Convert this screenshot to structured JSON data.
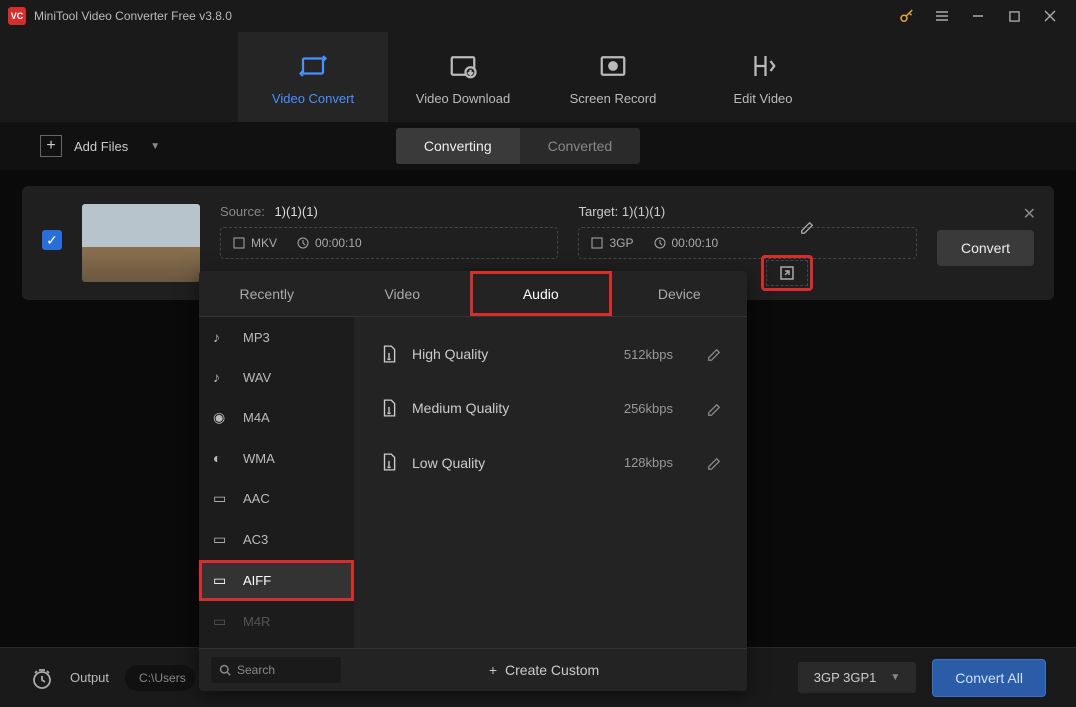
{
  "app": {
    "title": "MiniTool Video Converter Free v3.8.0",
    "logo_text": "VC"
  },
  "mainnav": {
    "tabs": [
      {
        "label": "Video Convert",
        "active": true
      },
      {
        "label": "Video Download"
      },
      {
        "label": "Screen Record"
      },
      {
        "label": "Edit Video"
      }
    ]
  },
  "toolbar": {
    "add_files": "Add Files",
    "segments": {
      "converting": "Converting",
      "converted": "Converted"
    }
  },
  "file": {
    "source_label": "Source:",
    "source_name": "1)(1)(1)",
    "source_format": "MKV",
    "source_duration": "00:00:10",
    "target_label": "Target:",
    "target_name": "1)(1)(1)",
    "target_format": "3GP",
    "target_duration": "00:00:10",
    "convert_btn": "Convert"
  },
  "dropdown": {
    "tabs": [
      "Recently",
      "Video",
      "Audio",
      "Device"
    ],
    "active_tab": "Audio",
    "formats": [
      "MP3",
      "WAV",
      "M4A",
      "WMA",
      "AAC",
      "AC3",
      "AIFF",
      "M4R"
    ],
    "selected_format": "AIFF",
    "qualities": [
      {
        "name": "High Quality",
        "rate": "512kbps"
      },
      {
        "name": "Medium Quality",
        "rate": "256kbps"
      },
      {
        "name": "Low Quality",
        "rate": "128kbps"
      }
    ],
    "search_placeholder": "Search",
    "create_custom": "Create Custom"
  },
  "bottombar": {
    "output_label": "Output",
    "output_path": "C:\\Users",
    "preset": "3GP 3GP1",
    "convert_all": "Convert All"
  }
}
